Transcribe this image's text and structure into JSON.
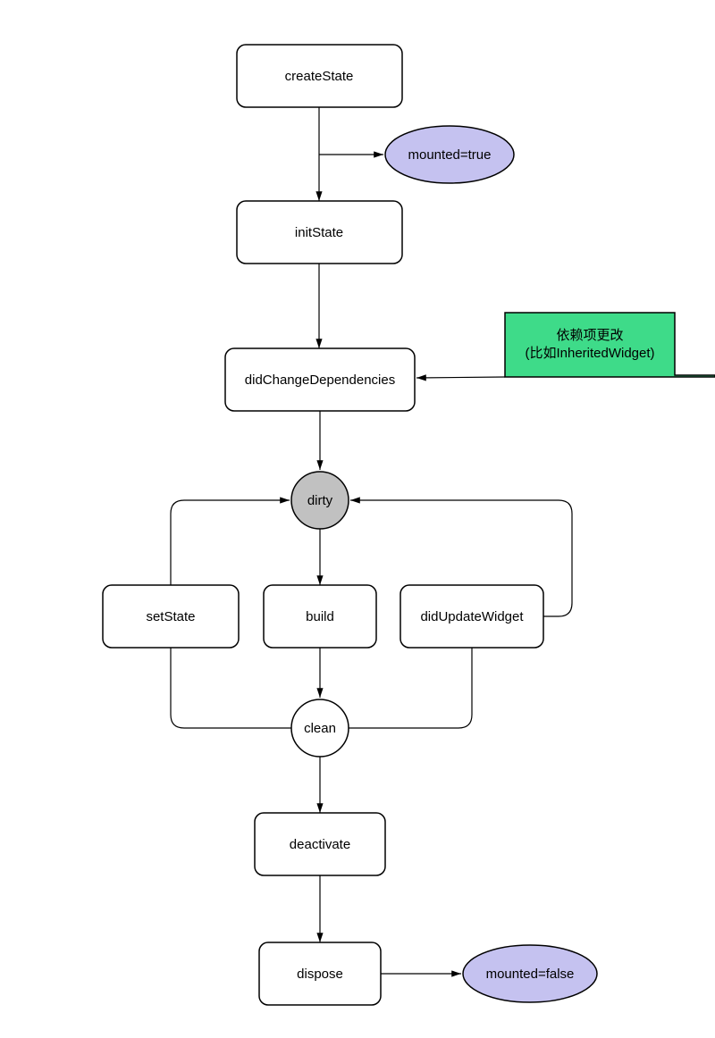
{
  "nodes": {
    "createState": "createState",
    "mountedTrue": "mounted=true",
    "initState": "initState",
    "didChangeDependencies": "didChangeDependencies",
    "dependencyChange1": "依赖项更改",
    "dependencyChange2": "(比如InheritedWidget)",
    "dirty": "dirty",
    "setState": "setState",
    "build": "build",
    "didUpdateWidget": "didUpdateWidget",
    "clean": "clean",
    "deactivate": "deactivate",
    "dispose": "dispose",
    "mountedFalse": "mounted=false"
  },
  "colors": {
    "purple": "#C5C2F0",
    "green": "#3EDB89",
    "gray": "#C1C1C1"
  }
}
